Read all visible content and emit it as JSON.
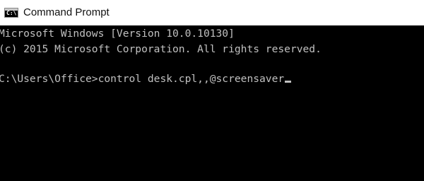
{
  "window": {
    "title": "Command Prompt",
    "icon": "console-icon",
    "icon_glyph": "C:\\"
  },
  "console": {
    "lines": [
      "Microsoft Windows [Version 10.0.10130]",
      "(c) 2015 Microsoft Corporation. All rights reserved.",
      "",
      "C:\\Users\\Office>control desk.cpl,,@screensaver"
    ],
    "text_color": "#c0c0c0",
    "background_color": "#000000"
  }
}
